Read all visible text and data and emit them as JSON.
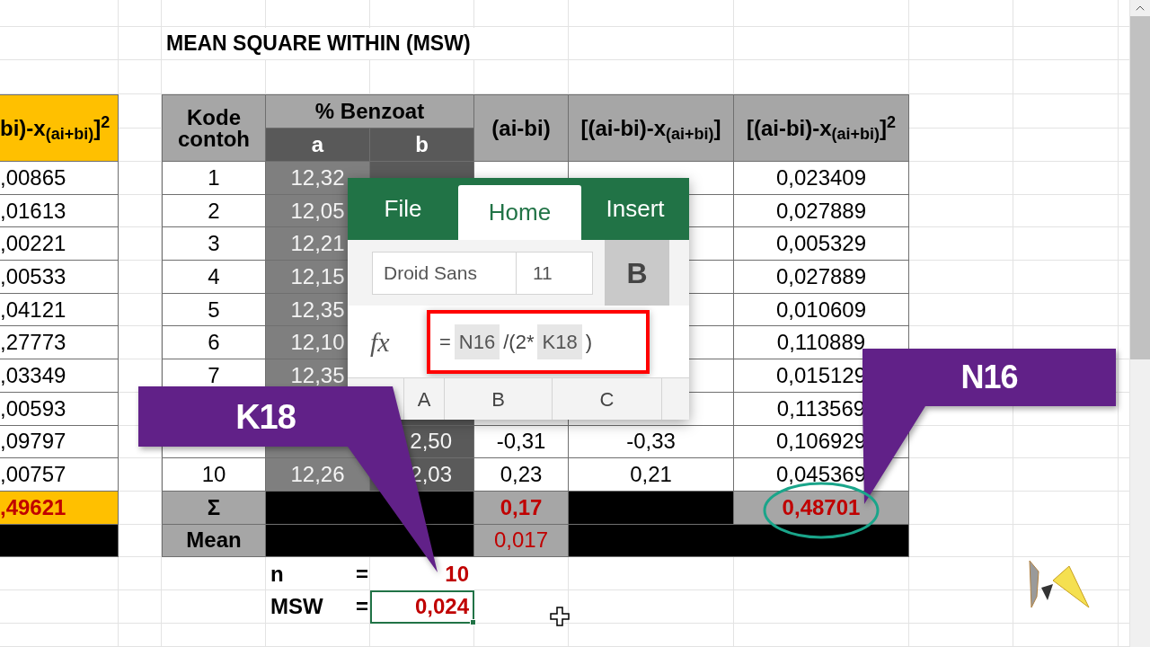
{
  "title": "MEAN SQUARE WITHIN (MSW)",
  "table": {
    "column_1_header": "bi)-x$_{(ai+bi)}$]$^{2}$",
    "headers": {
      "kode": "Kode contoh",
      "group": "% Benzoat",
      "a": "a",
      "b": "b",
      "diff": "(ai-bi)",
      "dev": "[(ai-bi)-x$_{(ai+bi)}$]",
      "sq": "[(ai-bi)-x$_{(ai+bi)}$]$^{2}$"
    },
    "rows": [
      {
        "column_1": ",00865",
        "kode": "1",
        "a": "12,32",
        "sq": "0,023409"
      },
      {
        "column_1": ",01613",
        "kode": "2",
        "a": "12,05",
        "sq": "0,027889"
      },
      {
        "column_1": ",00221",
        "kode": "3",
        "a": "12,21",
        "sq": "0,005329"
      },
      {
        "column_1": ",00533",
        "kode": "4",
        "a": "12,15",
        "sq": "0,027889"
      },
      {
        "column_1": ",04121",
        "kode": "5",
        "a": "12,35",
        "sq": "0,010609"
      },
      {
        "column_1": ",27773",
        "kode": "6",
        "a": "12,10",
        "sq": "0,110889"
      },
      {
        "column_1": ",03349",
        "kode": "7",
        "a": "12,35",
        "sq": "0,015129"
      },
      {
        "column_1": ",00593",
        "sq": "0,113569"
      },
      {
        "column_1": ",09797",
        "b": "2,50",
        "diff": "-0,31",
        "dev": "-0,33",
        "sq": "0,106929"
      },
      {
        "column_1": ",00757",
        "kode": "10",
        "a": "12,26",
        "b": "2,03",
        "diff": "0,23",
        "dev": "0,21",
        "sq": "0,045369"
      }
    ],
    "sum_row": {
      "column_1": ",49621",
      "label": "Σ",
      "diff": "0,17",
      "sq": "0,48701"
    },
    "mean_row": {
      "label": "Mean",
      "diff": "0,017"
    }
  },
  "results": [
    {
      "label": "n",
      "equals": "=",
      "value": "10",
      "selected": false
    },
    {
      "label": "MSW",
      "equals": "=",
      "value": "0,024",
      "selected": true
    }
  ],
  "ribbon": {
    "tabs": [
      {
        "label": "File",
        "selected": false
      },
      {
        "label": "Home",
        "selected": true
      },
      {
        "label": "Insert",
        "selected": false
      }
    ],
    "font_name": "Droid Sans",
    "font_size": "11",
    "bold_button": "B",
    "fx": "fx",
    "formula": [
      {
        "text": "=",
        "kind": "plain"
      },
      {
        "text": "N16",
        "kind": "ref"
      },
      {
        "text": "/(2*",
        "kind": "plain"
      },
      {
        "text": "K18",
        "kind": "ref"
      },
      {
        "text": ")",
        "kind": "plain"
      }
    ],
    "column_headers": [
      "A",
      "B",
      "C"
    ]
  },
  "callouts": [
    {
      "label": "K18"
    },
    {
      "label": "N16"
    }
  ]
}
